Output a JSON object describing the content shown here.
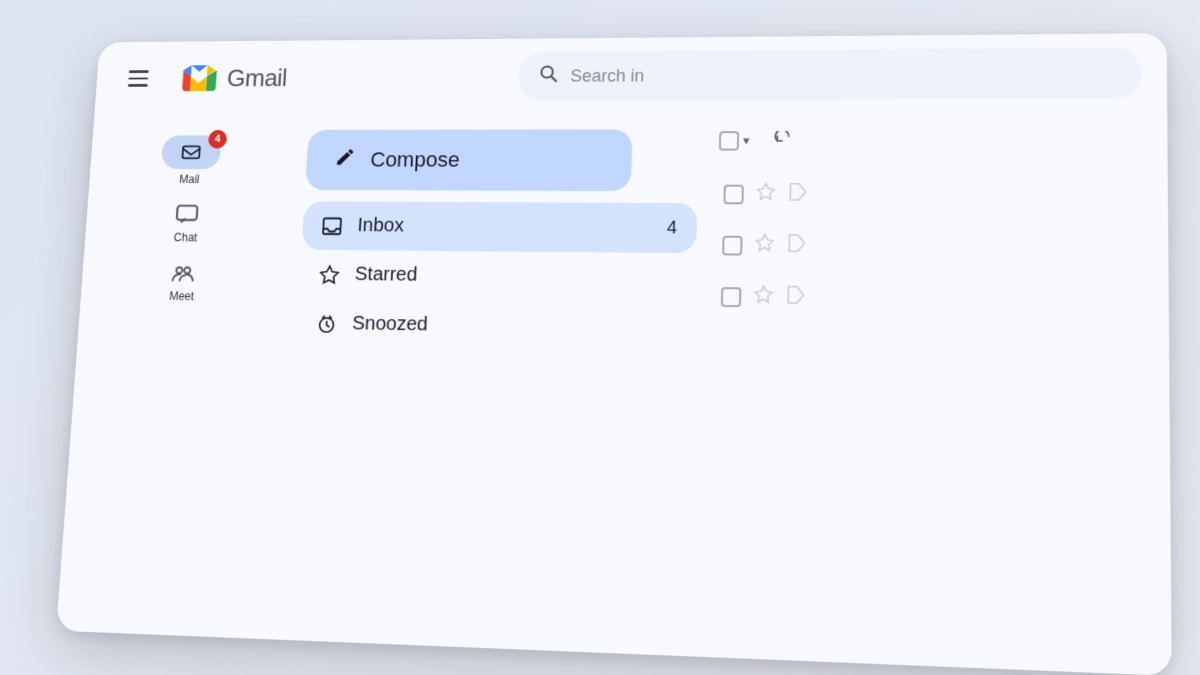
{
  "app": {
    "title": "Gmail",
    "search_placeholder": "Search in"
  },
  "sidebar": {
    "menu_label": "Menu",
    "nav_items": [
      {
        "id": "mail",
        "label": "Mail",
        "badge": "4",
        "has_badge": true
      },
      {
        "id": "chat",
        "label": "Chat",
        "has_badge": false
      },
      {
        "id": "meet",
        "label": "Meet",
        "has_badge": false
      }
    ]
  },
  "compose": {
    "label": "Compose",
    "icon": "✏"
  },
  "nav_list": [
    {
      "id": "inbox",
      "label": "Inbox",
      "count": "4",
      "active": true
    },
    {
      "id": "starred",
      "label": "Starred",
      "count": "",
      "active": false
    },
    {
      "id": "snoozed",
      "label": "Snoozed",
      "count": "",
      "active": false
    }
  ],
  "toolbar": {
    "select_all_label": "",
    "refresh_label": "↺"
  },
  "email_rows": [
    {
      "id": 1
    },
    {
      "id": 2
    },
    {
      "id": 3
    }
  ],
  "colors": {
    "compose_bg": "#c2d7ff",
    "inbox_bg": "#d3e3fd",
    "mail_icon_bg": "#c2d3f5",
    "badge_bg": "#d93025",
    "accent": "#1a73e8"
  }
}
